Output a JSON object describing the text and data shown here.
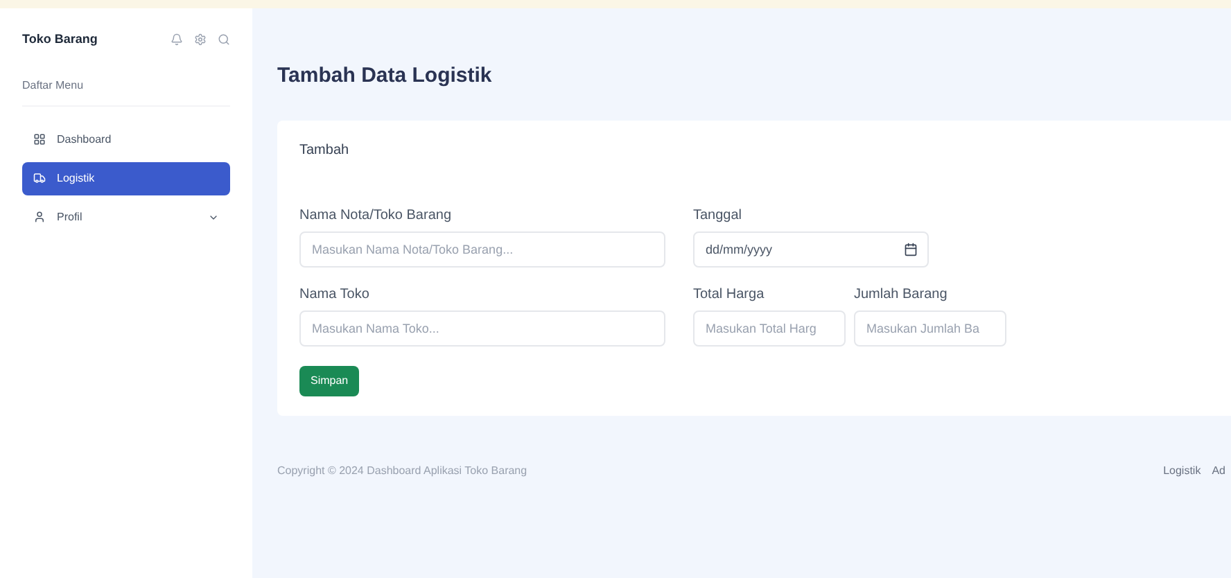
{
  "sidebar": {
    "brand": "Toko Barang",
    "section_title": "Daftar Menu",
    "items": [
      {
        "label": "Dashboard",
        "kind": "grid",
        "selected": false,
        "has_submenu": false
      },
      {
        "label": "Logistik",
        "kind": "truck",
        "selected": true,
        "has_submenu": false
      },
      {
        "label": "Profil",
        "kind": "user",
        "selected": false,
        "has_submenu": true
      }
    ]
  },
  "page_title": "Tambah Data Logistik",
  "card": {
    "title": "Tambah",
    "fields": [
      {
        "label": "Nama Nota/Toko Barang",
        "placeholder": "Masukan Nama Nota/Toko Barang...",
        "kind": "text"
      },
      {
        "label": "Tanggal",
        "placeholder": "dd/mm/yyyy",
        "kind": "date"
      },
      {
        "label": "Nama Toko",
        "placeholder": "Masukan Nama Toko...",
        "kind": "text"
      },
      {
        "label": "Total Harga",
        "placeholder": "Masukan Total Harg",
        "kind": "text"
      },
      {
        "label": "Jumlah Barang",
        "placeholder": "Masukan Jumlah Ba",
        "kind": "text"
      }
    ],
    "submit": "Simpan"
  },
  "footer": {
    "copyright": "Copyright © 2024 Dashboard Aplikasi Toko Barang",
    "links": [
      "Logistik",
      "Ad"
    ]
  }
}
